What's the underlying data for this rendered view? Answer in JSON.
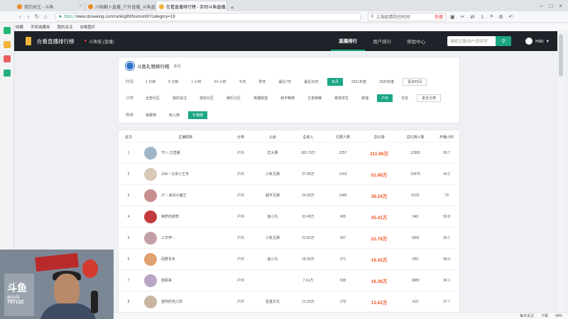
{
  "browser": {
    "tabs": [
      {
        "label": "我的关注 - 斗鱼"
      },
      {
        "label": "川味翻卜直播_户外直播_斗鱼直..."
      },
      {
        "label": "在看直播排行榜 - 实时斗鱼直播..."
      }
    ],
    "url_proto": "https://",
    "url_rest": "www.doseeing.com/rank/gift/thismonth?category=19",
    "search_text": "上海疫情防控时间",
    "search_hot": "热搜",
    "bookmarks": [
      "收藏",
      "手机收藏夹",
      "我的关注",
      "谷歌图片"
    ],
    "status_items": [
      "每日关注",
      "下载",
      "40%"
    ]
  },
  "site": {
    "name": "在看直播排行榜",
    "location": "斗鱼版 (直播)",
    "nav": [
      "直播排行",
      "用户排行",
      "帮助中心"
    ],
    "search_placeholder": "搜索主播/用户/房间号",
    "user": "Hdc"
  },
  "ranking": {
    "title": "斗鱼礼物排行榜",
    "subtitle": "本月",
    "time_label": "时间",
    "time_options": [
      "1 分钟",
      "5 分钟",
      "1 小时",
      "24 小时",
      "今天",
      "昨天",
      "最近7天",
      "最近30天",
      "本月",
      "2021年度",
      "2020年度",
      "更多时间"
    ],
    "category_label": "分类",
    "category_options": [
      "全部分区",
      "我的关注",
      "游戏分区",
      "娱乐分区",
      "英雄联盟",
      "和平精英",
      "王者荣耀",
      "绝地求生",
      "颜值",
      "户外",
      "交友",
      "更多分类"
    ],
    "board_label": "榜单",
    "board_options": [
      "弹幕榜",
      "收入榜",
      "礼物榜"
    ]
  },
  "table": {
    "headers": [
      "名次",
      "主播昵称",
      "分类",
      "公会",
      "总收入",
      "付费人数",
      "总礼物",
      "总礼物人数",
      "开播小时"
    ],
    "rows": [
      {
        "rank": "1",
        "name": "TD丶正直播",
        "category": "户外",
        "guild": "优大赛",
        "income": "182.76万",
        "payers": "2257",
        "gift": "211.96万",
        "gift_people": "12983",
        "hours": "58.7"
      },
      {
        "rank": "2",
        "name": "JSA丶北京小王爷",
        "category": "户外",
        "guild": "小象互娱",
        "income": "27.95万",
        "payers": "1416",
        "gift": "51.86万",
        "gift_people": "10075",
        "hours": "43.2"
      },
      {
        "rank": "3",
        "name": "JT丶浪哥大魔王",
        "category": "户外",
        "guild": "超丰互娱",
        "income": "24.30万",
        "payers": "1440",
        "gift": "38.24万",
        "gift_people": "6102",
        "hours": "79"
      },
      {
        "rank": "4",
        "name": "嗨梦的旅帮",
        "category": "户外",
        "guild": "鱼小丸",
        "income": "32.49万",
        "payers": "405",
        "gift": "35.41万",
        "gift_people": "949",
        "hours": "59.8"
      },
      {
        "rank": "5",
        "name": "三岁伊丶",
        "category": "户外",
        "guild": "小象互娱",
        "income": "21.82万",
        "payers": "657",
        "gift": "22.79万",
        "gift_people": "1892",
        "hours": "30.1"
      },
      {
        "rank": "6",
        "name": "阎野青年",
        "category": "户外",
        "guild": "鱼小丸",
        "income": "18.30万",
        "payers": "271",
        "gift": "19.43万",
        "gift_people": "655",
        "hours": "98.4"
      },
      {
        "rank": "7",
        "name": "炮耶来",
        "category": "户外",
        "guild": "",
        "income": "7.61万",
        "payers": "538",
        "gift": "16.36万",
        "gift_people": "3880",
        "hours": "34.1"
      },
      {
        "rank": "8",
        "name": "望阿的范儿样",
        "category": "户外",
        "guild": "星盘文化",
        "income": "13.30万",
        "payers": "278",
        "gift": "13.62万",
        "gift_people": "610",
        "hours": "37.7"
      }
    ]
  },
  "webcam": {
    "logo": "斗鱼",
    "room_label": "房间号",
    "room_number": "787122"
  },
  "colors": {
    "accent": "#1ba784",
    "header_bg": "#1f2329",
    "gift_value": "#f0541e"
  }
}
